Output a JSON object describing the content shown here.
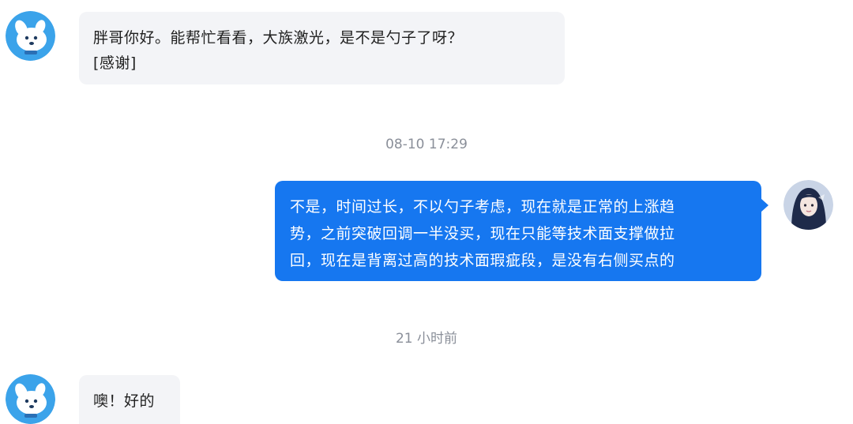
{
  "messages": [
    {
      "sender": "incoming",
      "avatar_icon": "dog-cartoon-icon",
      "lines": [
        "胖哥你好。能帮忙看看，大族激光，是不是勺子了呀？",
        "[感谢]"
      ]
    },
    {
      "timestamp": "08-10 17:29"
    },
    {
      "sender": "outgoing",
      "avatar_icon": "girl-portrait-icon",
      "lines": [
        "不是，时间过长，不以勺子考虑，现在就是正常的上涨趋",
        "势，之前突破回调一半没买，现在只能等技术面支撑做拉",
        "回，现在是背离过高的技术面瑕疵段，是没有右侧买点的"
      ]
    },
    {
      "timestamp": "21 小时前"
    },
    {
      "sender": "incoming",
      "avatar_icon": "dog-cartoon-icon",
      "lines": [
        "噢！好的"
      ]
    }
  ],
  "colors": {
    "outgoing_bubble": "#1677f0",
    "incoming_bubble": "#f3f4f7",
    "timestamp_text": "#8a8f99",
    "avatar_bg": "#3ba3ea"
  }
}
